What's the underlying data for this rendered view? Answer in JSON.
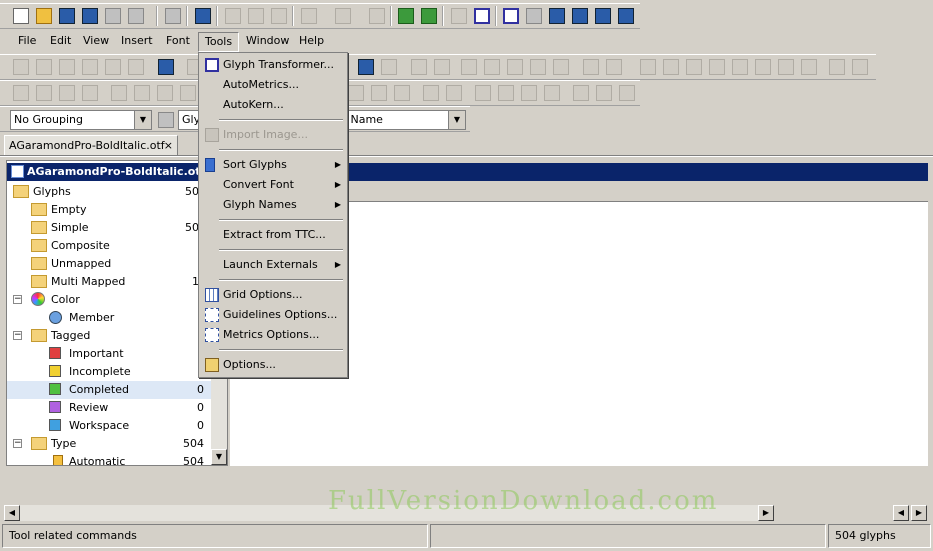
{
  "menubar": [
    "File",
    "Edit",
    "View",
    "Insert",
    "Font",
    "Tools",
    "Window",
    "Help"
  ],
  "toolbar3": {
    "grouping_select": "No Grouping",
    "glyph_select": "Gly",
    "name_select": "n Name"
  },
  "document_tab": "AGaramondPro-BoldItalic.otf",
  "tree": {
    "title": "AGaramondPro-BoldItalic.otf -",
    "rows": [
      {
        "label": "Glyphs",
        "count": "50"
      },
      {
        "label": "Empty",
        "count": ""
      },
      {
        "label": "Simple",
        "count": "50"
      },
      {
        "label": "Composite",
        "count": ""
      },
      {
        "label": "Unmapped",
        "count": ""
      },
      {
        "label": "Multi Mapped",
        "count": "1"
      },
      {
        "label": "Color",
        "count": ""
      },
      {
        "label": "Member",
        "count": ""
      },
      {
        "label": "Tagged",
        "count": ""
      },
      {
        "label": "Important",
        "count": ""
      },
      {
        "label": "Incomplete",
        "count": ""
      },
      {
        "label": "Completed",
        "count": "0"
      },
      {
        "label": "Review",
        "count": "0"
      },
      {
        "label": "Workspace",
        "count": "0"
      },
      {
        "label": "Type",
        "count": "504"
      },
      {
        "label": "Automatic",
        "count": "504"
      }
    ]
  },
  "tools_menu": {
    "items": [
      {
        "label": "Glyph Transformer...",
        "icon": "glyph-transformer-icon",
        "disabled": false,
        "submenu": false
      },
      {
        "label": "AutoMetrics...",
        "icon": "",
        "disabled": false,
        "submenu": false
      },
      {
        "label": "AutoKern...",
        "icon": "",
        "disabled": false,
        "submenu": false
      },
      {
        "label": "Import Image...",
        "icon": "image-icon",
        "disabled": true,
        "submenu": false
      },
      {
        "label": "Sort Glyphs",
        "icon": "sort-icon",
        "disabled": false,
        "submenu": true
      },
      {
        "label": "Convert Font",
        "icon": "",
        "disabled": false,
        "submenu": true
      },
      {
        "label": "Glyph Names",
        "icon": "",
        "disabled": false,
        "submenu": true
      },
      {
        "label": "Extract from TTC...",
        "icon": "",
        "disabled": false,
        "submenu": false
      },
      {
        "label": "Launch Externals",
        "icon": "",
        "disabled": false,
        "submenu": true
      },
      {
        "label": "Grid Options...",
        "icon": "grid-icon",
        "disabled": false,
        "submenu": false
      },
      {
        "label": "Guidelines Options...",
        "icon": "guidelines-icon",
        "disabled": false,
        "submenu": false
      },
      {
        "label": "Metrics Options...",
        "icon": "metrics-icon",
        "disabled": false,
        "submenu": false
      },
      {
        "label": "Options...",
        "icon": "options-icon",
        "disabled": false,
        "submenu": false
      }
    ]
  },
  "status": {
    "left": "Tool related commands",
    "right": "504 glyphs"
  },
  "watermark": "FullVersionDownload.com",
  "colors": {
    "title_bar": "#0a246a",
    "face": "#d4d0c8",
    "selected_row": "#dde8f6"
  }
}
